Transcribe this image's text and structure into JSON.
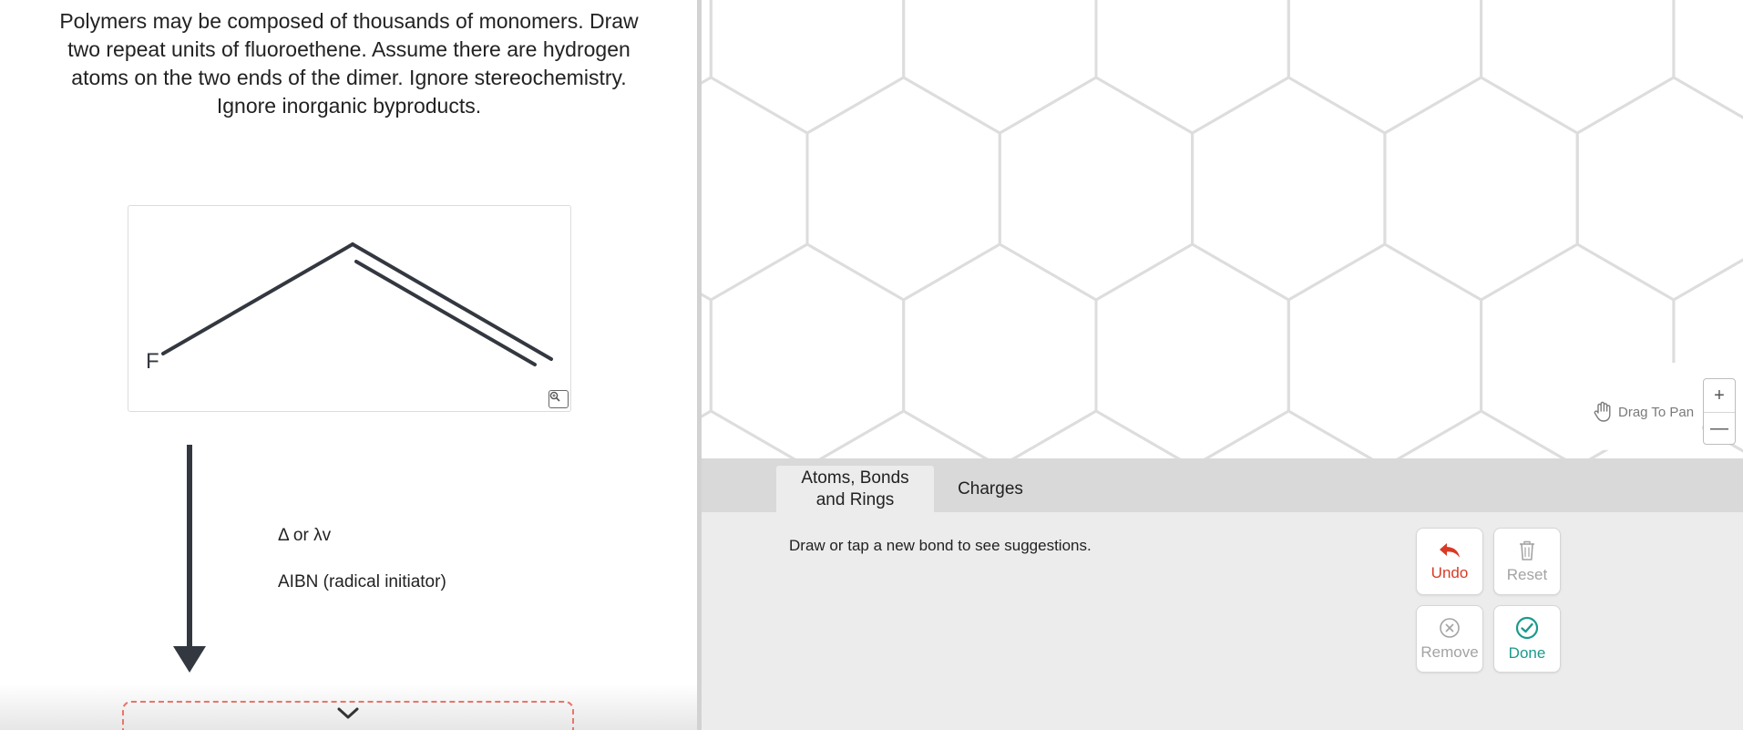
{
  "question": {
    "lines": [
      "Polymers may be composed of thousands of monomers. Draw",
      "two repeat units of fluoroethene. Assume there are hydrogen",
      "atoms on the two ends of the dimer. Ignore stereochemistry.",
      "Ignore inorganic byproducts."
    ]
  },
  "molecule": {
    "atom_label": "F"
  },
  "reaction": {
    "condition_1": "Δ or λv",
    "condition_2": "AIBN (radical initiator)"
  },
  "canvas": {
    "pan_label": "Drag To Pan",
    "zoom_in": "+",
    "zoom_out": "—"
  },
  "tabs": [
    {
      "label": "Atoms, Bonds and Rings",
      "line1": "Atoms, Bonds",
      "line2": "and Rings",
      "active": true
    },
    {
      "label": "Charges",
      "active": false
    }
  ],
  "tools": {
    "hint": "Draw or tap a new bond to see suggestions."
  },
  "actions": {
    "undo": "Undo",
    "reset": "Reset",
    "remove": "Remove",
    "done": "Done"
  },
  "colors": {
    "undo": "#d93a25",
    "done": "#1a9a8b",
    "disabled": "#a3a3a3",
    "answer_box_border": "#e8756a",
    "grid_line": "#dddddd",
    "bond": "#333840"
  }
}
